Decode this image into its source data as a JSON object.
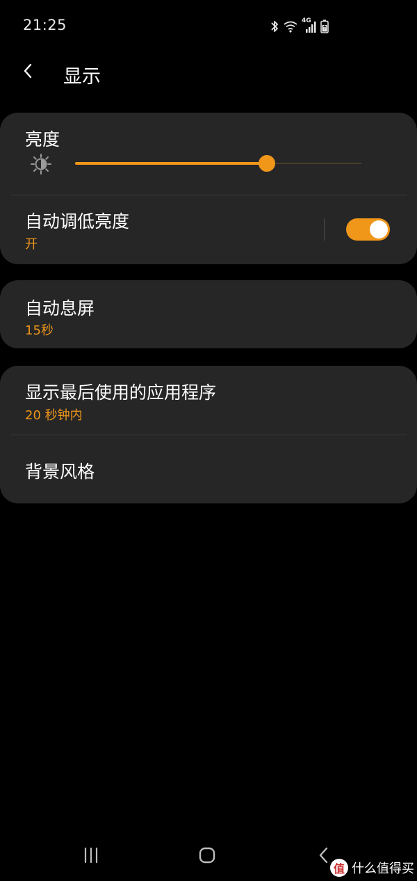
{
  "status_bar": {
    "time": "21:25",
    "icons": [
      "bluetooth-icon",
      "wifi-icon",
      "4g-signal-icon",
      "battery-charging-icon"
    ],
    "network_label": "4G"
  },
  "header": {
    "back_icon": "chevron-left-icon",
    "title": "显示"
  },
  "brightness": {
    "label": "亮度",
    "icon": "brightness-icon",
    "level": 0.67
  },
  "auto_dim": {
    "title": "自动调低亮度",
    "status": "开",
    "enabled": true
  },
  "screen_timeout": {
    "title": "自动息屏",
    "value": "15秒"
  },
  "recent_apps": {
    "title": "显示最后使用的应用程序",
    "value": "20 秒钟内"
  },
  "background_style": {
    "title": "背景风格"
  },
  "nav_bar": {
    "icons": [
      "recents-icon",
      "home-icon",
      "back-icon"
    ]
  },
  "watermark": {
    "logo_char": "值",
    "text": "什么值得买"
  },
  "colors": {
    "accent": "#f0971a",
    "card_background": "#262626",
    "page_background": "#000000"
  }
}
